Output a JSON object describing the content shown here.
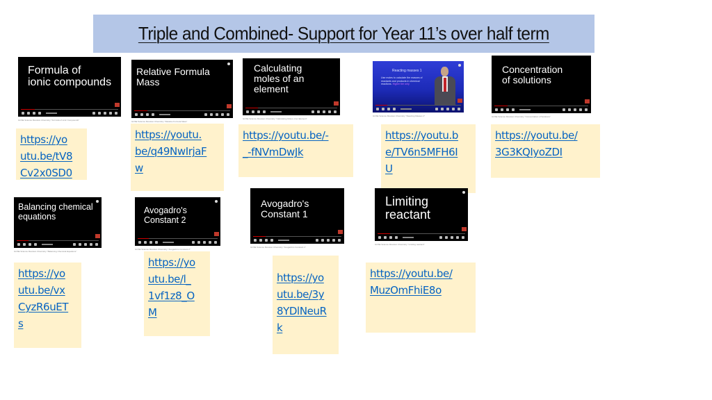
{
  "title": "Triple and Combined- Support for Year 11’s over half term",
  "colors": {
    "title_background": "#b4c6e7",
    "link_box_background": "#fff2cc",
    "link_color": "#0563c1"
  },
  "videos": [
    {
      "id": "formula-ionic",
      "thumbnail_title": "Formula of ionic compounds",
      "thumbnail_lines": [
        "Formula of",
        "ionic compounds"
      ],
      "caption": "GCSE Science Revision Chemistry \"Formula of ionic Compounds\"",
      "link_lines": [
        "https://yo",
        "utu.be/tV8",
        "Cv2x0SD0"
      ],
      "link": "https://youtu.be/tV8Cv2x0SD0"
    },
    {
      "id": "relative-formula-mass",
      "thumbnail_title": "Relative Formula Mass",
      "thumbnail_lines": [
        "Relative Formula",
        "Mass"
      ],
      "caption": "GCSE Science Revision Chemistry \"Relative Formula Mass\"",
      "link_lines": [
        "https://youtu.",
        "be/q49NwIrjaF",
        "w"
      ],
      "link": "https://youtu.be/q49NwIrjaFw"
    },
    {
      "id": "calculating-moles",
      "thumbnail_title": "Calculating moles of an element",
      "thumbnail_lines": [
        "Calculating",
        "moles of an",
        "element"
      ],
      "caption": "GCSE Science Revision Chemistry \"Calculating Moles of an Element\"",
      "link_lines": [
        "https://youtu.be/-",
        "_-fNVmDwJk"
      ],
      "link": "https://youtu.be/-_-fNVmDwJk"
    },
    {
      "id": "reacting-masses",
      "thumbnail_title": "Reacting masses 1",
      "thumbnail_lines": [
        "Reacting masses 1"
      ],
      "slide_bullet": "Use moles to calculate the masses of reactants and products in chemical reactions.",
      "slide_highlight": "Higher tier only",
      "caption": "GCSE Science Revision Chemistry \"Reacting Masses 1\"",
      "link_lines": [
        "https://youtu.b",
        "e/TV6n5MFH6I",
        "U"
      ],
      "link": "https://youtu.be/TV6n5MFH6IU"
    },
    {
      "id": "concentration",
      "thumbnail_title": "Concentration of solutions",
      "thumbnail_lines": [
        "Concentration",
        "of solutions"
      ],
      "caption": "GCSE Science Revision Chemistry \"Concentration of Solutions\"",
      "link_lines": [
        "https://youtu.be/",
        "3G3KQIyoZDI"
      ],
      "link": "https://youtu.be/3G3KQIyoZDI"
    },
    {
      "id": "balancing-equations",
      "thumbnail_title": "Balancing chemical equations",
      "thumbnail_lines": [
        "Balancing chemical",
        "equations"
      ],
      "caption": "GCSE Science Revision Chemistry \"Balancing Chemical Equations\"",
      "link_lines": [
        "https://yo",
        "utu.be/vx",
        "CyzR6uET",
        "s"
      ],
      "link": "https://youtu.be/vxCyzR6uETs"
    },
    {
      "id": "avogadro-2",
      "thumbnail_title": "Avogadro's Constant 2",
      "thumbnail_lines": [
        "Avogadro's",
        "Constant 2"
      ],
      "caption": "GCSE Science Revision Chemistry \"Avogadro's Constant 2\"",
      "link_lines": [
        "https://yo",
        "utu.be/l_",
        "1vf1z8_O",
        "M"
      ],
      "link": "https://youtu.be/l_1vf1z8_OM"
    },
    {
      "id": "avogadro-1",
      "thumbnail_title": "Avogadro's Constant 1",
      "thumbnail_lines": [
        "Avogadro's",
        "Constant 1"
      ],
      "caption": "GCSE Science Revision Chemistry \"Avogadro's Constant 1\"",
      "link_lines": [
        "https://yo",
        "utu.be/3y",
        "8YDlNeuR",
        "k"
      ],
      "link": "https://youtu.be/3y8YDlNeuRk"
    },
    {
      "id": "limiting-reactant",
      "thumbnail_title": "Limiting reactant",
      "thumbnail_lines": [
        "Limiting",
        "reactant"
      ],
      "caption": "GCSE Science Revision Chemistry \"Limiting reactant\"",
      "link_lines": [
        "https://youtu.be/",
        "MuzOmFhiE8o"
      ],
      "link": "https://youtu.be/MuzOmFhiE8o"
    }
  ]
}
